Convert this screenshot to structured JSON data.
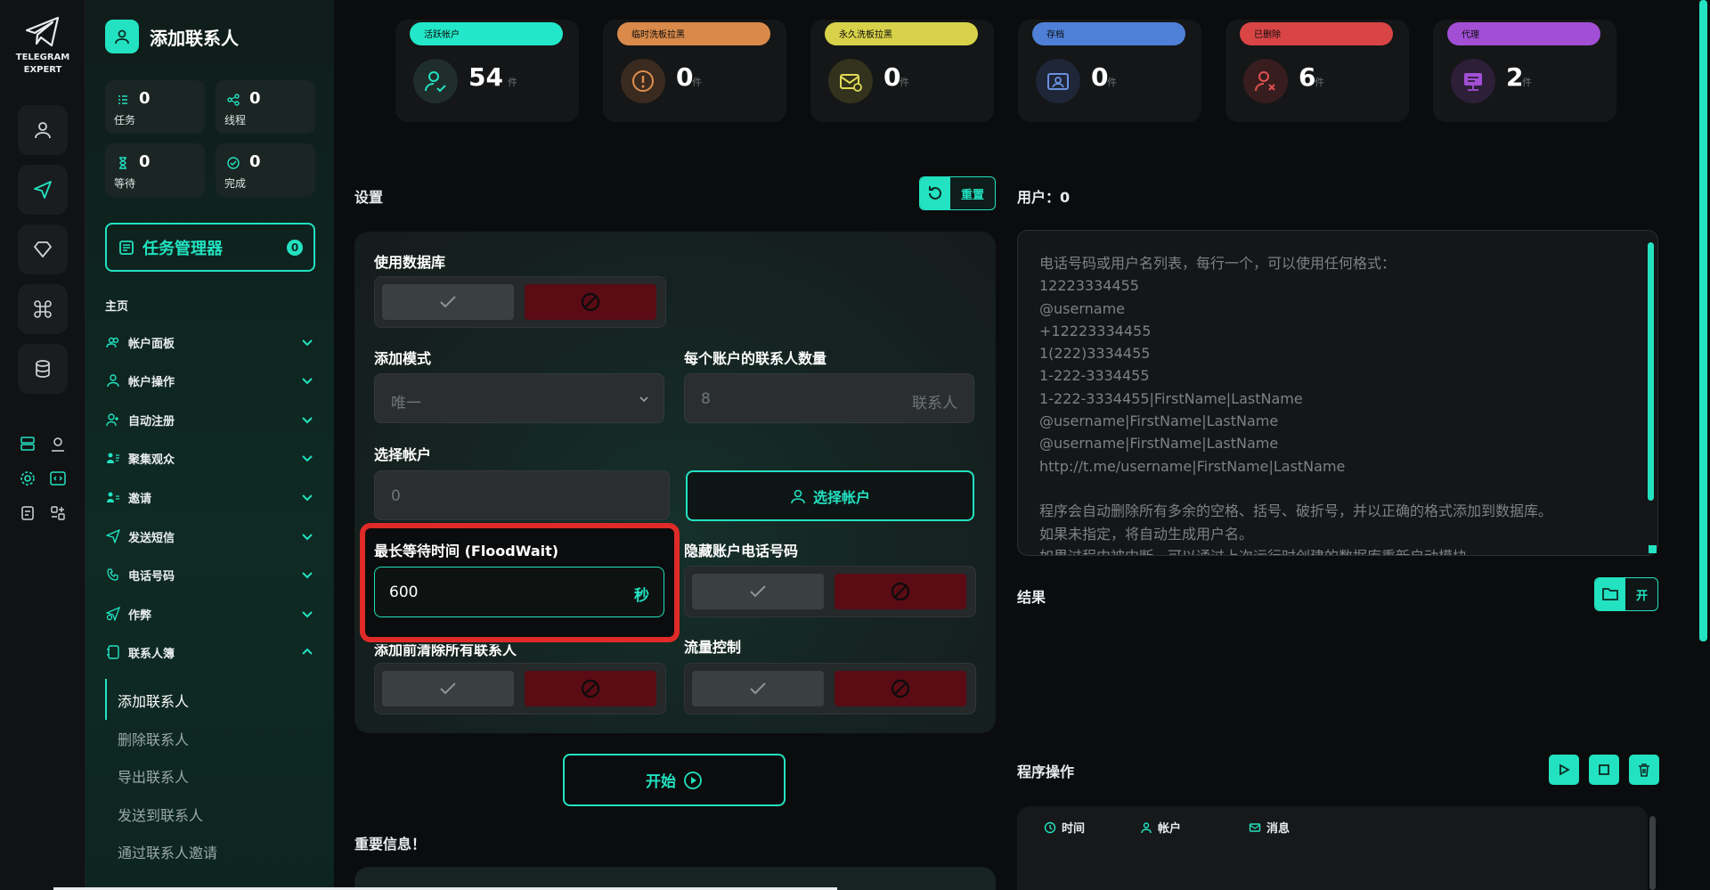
{
  "brand": {
    "line1": "TELEGRAM",
    "line2": "EXPERT"
  },
  "header": {
    "title": "添加联系人"
  },
  "stats": [
    {
      "value": "0",
      "label": "任务"
    },
    {
      "value": "0",
      "label": "线程"
    },
    {
      "value": "0",
      "label": "等待"
    },
    {
      "value": "0",
      "label": "完成"
    }
  ],
  "task_manager": {
    "label": "任务管理器",
    "count": "0"
  },
  "nav": {
    "heading": "主页",
    "items": [
      {
        "label": "帐户面板"
      },
      {
        "label": "帐户操作"
      },
      {
        "label": "自动注册"
      },
      {
        "label": "聚集观众"
      },
      {
        "label": "邀请"
      },
      {
        "label": "发送短信"
      },
      {
        "label": "电话号码"
      },
      {
        "label": "作弊"
      },
      {
        "label": "联系人簿"
      }
    ],
    "submenu": [
      {
        "label": "添加联系人"
      },
      {
        "label": "删除联系人"
      },
      {
        "label": "导出联系人"
      },
      {
        "label": "发送到联系人"
      },
      {
        "label": "通过联系人邀请"
      }
    ]
  },
  "cards": [
    {
      "tag": "活跃帐户",
      "value": "54",
      "unit": "件",
      "color": "#22e8c9"
    },
    {
      "tag": "临时洗板拉黑",
      "value": "0",
      "unit": "件",
      "color": "#d98a4a"
    },
    {
      "tag": "永久洗板拉黑",
      "value": "0",
      "unit": "件",
      "color": "#d8d24a"
    },
    {
      "tag": "存档",
      "value": "0",
      "unit": "件",
      "color": "#4f80d8"
    },
    {
      "tag": "已删除",
      "value": "6",
      "unit": "件",
      "color": "#d94545"
    },
    {
      "tag": "代理",
      "value": "2",
      "unit": "件",
      "color": "#a24fd6"
    }
  ],
  "settings": {
    "title": "设置",
    "reset_label": "重置",
    "use_db_label": "使用数据库",
    "add_mode_label": "添加模式",
    "add_mode_value": "唯一",
    "contacts_per_account_label": "每个账户的联系人数量",
    "contacts_per_account_value": "8",
    "contacts_unit": "联系人",
    "select_account_label": "选择帐户",
    "select_account_value": "0",
    "choose_account_button": "选择帐户",
    "floodwait_label": "最长等待时间 (FloodWait)",
    "floodwait_value": "600",
    "floodwait_unit": "秒",
    "hide_phone_label": "隐藏账户电话号码",
    "clear_contacts_label": "添加前清除所有联系人",
    "traffic_label": "流量控制"
  },
  "start_label": "开始",
  "important_title": "重要信息！",
  "users": {
    "title": "用户：0",
    "placeholder_lines": [
      "电话号码或用户名列表，每行一个，可以使用任何格式：",
      "12223334455",
      "@username",
      "+12223334455",
      "1(222)3334455",
      "1-222-3334455",
      "1-222-3334455|FirstName|LastName",
      "@username|FirstName|LastName",
      "@username|FirstName|LastName",
      "http://t.me/username|FirstName|LastName",
      "",
      "程序会自动删除所有多余的空格、括号、破折号，并以正确的格式添加到数据库。",
      "如果未指定，将自动生成用户名。",
      "如果过程中被中断，可以通过上次运行时创建的数据库重新启动模块"
    ]
  },
  "results": {
    "title": "结果",
    "open_label": "开"
  },
  "program_ops": {
    "title": "程序操作",
    "columns": [
      "时间",
      "帐户",
      "消息"
    ]
  },
  "accent_color": "#22e2c1",
  "highlight_color": "#e02a27"
}
